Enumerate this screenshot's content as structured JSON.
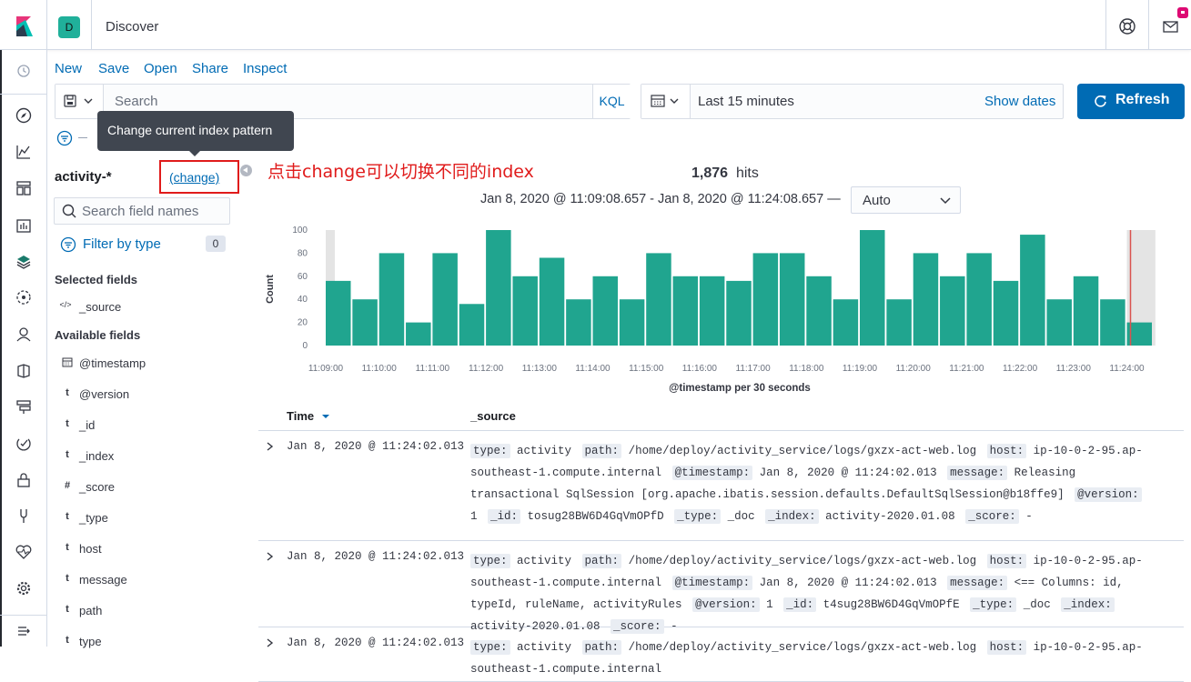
{
  "header": {
    "space_initial": "D",
    "page_title": "Discover",
    "icons": [
      "kibana-logo",
      "help-icon",
      "mail-icon"
    ]
  },
  "nav": {
    "icons": [
      "clock-icon",
      "discover-icon",
      "visualize-icon",
      "dashboard-icon",
      "canvas-icon",
      "maps-icon",
      "ml-icon",
      "siem-icon",
      "logs-icon",
      "infra-icon",
      "apm-icon",
      "uptime-icon",
      "devtools-icon",
      "monitoring-icon",
      "management-icon",
      "collapse-icon"
    ]
  },
  "menu": {
    "new": "New",
    "save": "Save",
    "open": "Open",
    "share": "Share",
    "inspect": "Inspect"
  },
  "query": {
    "placeholder": "Search",
    "language": "KQL"
  },
  "time": {
    "label": "Last 15 minutes",
    "show_dates": "Show dates",
    "refresh": "Refresh"
  },
  "tooltip": "Change current index pattern",
  "annotation": "点击change可以切换不同的index",
  "sidebar": {
    "index_pattern": "activity-*",
    "change_link": "(change)",
    "field_search_placeholder": "Search field names",
    "filter_by_type": "Filter by type",
    "filter_count": "0",
    "selected_title": "Selected fields",
    "available_title": "Available fields",
    "selected_fields": [
      {
        "type": "</>",
        "name": "_source"
      }
    ],
    "available_fields": [
      {
        "type": "cal",
        "name": "@timestamp"
      },
      {
        "type": "t",
        "name": "@version"
      },
      {
        "type": "t",
        "name": "_id"
      },
      {
        "type": "t",
        "name": "_index"
      },
      {
        "type": "#",
        "name": "_score"
      },
      {
        "type": "t",
        "name": "_type"
      },
      {
        "type": "t",
        "name": "host"
      },
      {
        "type": "t",
        "name": "message"
      },
      {
        "type": "t",
        "name": "path"
      },
      {
        "type": "t",
        "name": "type"
      }
    ]
  },
  "results": {
    "hits": "1,876",
    "hits_label": "hits",
    "range": "Jan 8, 2020 @ 11:09:08.657 - Jan 8, 2020 @ 11:24:08.657 —",
    "interval": "Auto"
  },
  "chart_data": {
    "type": "bar",
    "categories": [
      "11:09:00",
      "11:09:30",
      "11:10:00",
      "11:10:30",
      "11:11:00",
      "11:11:30",
      "11:12:00",
      "11:12:30",
      "11:13:00",
      "11:13:30",
      "11:14:00",
      "11:14:30",
      "11:15:00",
      "11:15:30",
      "11:16:00",
      "11:16:30",
      "11:17:00",
      "11:17:30",
      "11:18:00",
      "11:18:30",
      "11:19:00",
      "11:19:30",
      "11:20:00",
      "11:20:30",
      "11:21:00",
      "11:21:30",
      "11:22:00",
      "11:22:30",
      "11:23:00",
      "11:23:30",
      "11:24:00"
    ],
    "values": [
      56,
      40,
      80,
      20,
      80,
      36,
      100,
      60,
      76,
      40,
      60,
      40,
      80,
      60,
      60,
      56,
      80,
      80,
      60,
      40,
      100,
      40,
      80,
      60,
      80,
      56,
      96,
      40,
      60,
      40,
      20
    ],
    "xticks": [
      "11:09:00",
      "11:10:00",
      "11:11:00",
      "11:12:00",
      "11:13:00",
      "11:14:00",
      "11:15:00",
      "11:16:00",
      "11:17:00",
      "11:18:00",
      "11:19:00",
      "11:20:00",
      "11:21:00",
      "11:22:00",
      "11:23:00",
      "11:24:00"
    ],
    "yticks": [
      "0",
      "20",
      "40",
      "60",
      "80",
      "100"
    ],
    "ylim": [
      0,
      100
    ],
    "ylabel": "Count",
    "xlabel": "@timestamp per 30 seconds",
    "bar_color": "#20a58f",
    "partial_bucket_color": "#e4e4e4",
    "now_marker_color": "#d9534f"
  },
  "table": {
    "col_time": "Time",
    "col_source": "_source",
    "rows": [
      {
        "time": "Jan 8, 2020 @ 11:24:02.013",
        "fields": [
          {
            "k": "type:",
            "v": "activity"
          },
          {
            "k": "path:",
            "v": "/home/deploy/activity_service/logs/gxzx-act-web.log"
          },
          {
            "k": "host:",
            "v": "ip-10-0-2-95.ap-southeast-1.compute.internal"
          },
          {
            "k": "@timestamp:",
            "v": "Jan 8, 2020 @ 11:24:02.013"
          },
          {
            "k": "message:",
            "v": "Releasing transactional SqlSession [org.apache.ibatis.session.defaults.DefaultSqlSession@b18ffe9]"
          },
          {
            "k": "@version:",
            "v": "1"
          },
          {
            "k": "_id:",
            "v": "tosug28BW6D4GqVmOPfD"
          },
          {
            "k": "_type:",
            "v": "_doc"
          },
          {
            "k": "_index:",
            "v": "activity-2020.01.08"
          },
          {
            "k": "_score:",
            "v": "-"
          }
        ]
      },
      {
        "time": "Jan 8, 2020 @ 11:24:02.013",
        "fields": [
          {
            "k": "type:",
            "v": "activity"
          },
          {
            "k": "path:",
            "v": "/home/deploy/activity_service/logs/gxzx-act-web.log"
          },
          {
            "k": "host:",
            "v": "ip-10-0-2-95.ap-southeast-1.compute.internal"
          },
          {
            "k": "@timestamp:",
            "v": "Jan 8, 2020 @ 11:24:02.013"
          },
          {
            "k": "message:",
            "v": "<== Columns: id, typeId, ruleName, activityRules"
          },
          {
            "k": "@version:",
            "v": "1"
          },
          {
            "k": "_id:",
            "v": "t4sug28BW6D4GqVmOPfE"
          },
          {
            "k": "_type:",
            "v": "_doc"
          },
          {
            "k": "_index:",
            "v": "activity-2020.01.08"
          },
          {
            "k": "_score:",
            "v": "-"
          }
        ]
      },
      {
        "time": "Jan 8, 2020 @ 11:24:02.013",
        "fields": [
          {
            "k": "type:",
            "v": "activity"
          },
          {
            "k": "path:",
            "v": "/home/deploy/activity_service/logs/gxzx-act-web.log"
          },
          {
            "k": "host:",
            "v": "ip-10-0-2-95.ap-southeast-1.compute.internal"
          }
        ]
      }
    ]
  }
}
